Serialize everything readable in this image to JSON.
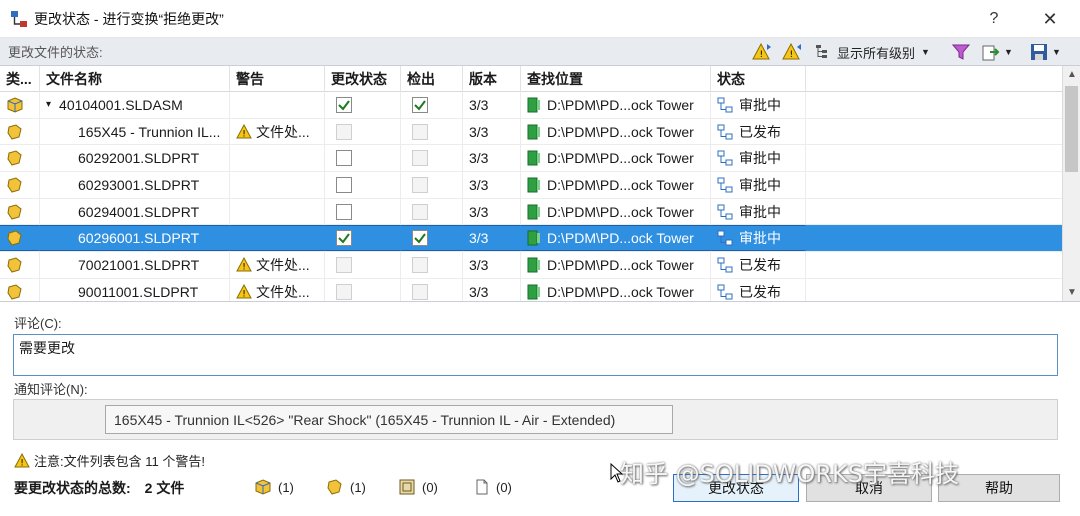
{
  "window": {
    "title": "更改状态 - 进行变换“拒绝更改”",
    "help_label": "?",
    "close_label": "✕"
  },
  "toolbar": {
    "caption": "更改文件的状态:",
    "level_filter_label": "显示所有级别"
  },
  "columns": [
    "类...",
    "文件名称",
    "警告",
    "更改状态",
    "检出",
    "版本",
    "查找位置",
    "状态"
  ],
  "rows": [
    {
      "name": "40104001.SLDASM",
      "expander": "▾",
      "warning": "",
      "change": "checked",
      "checkout": "checked",
      "version": "3/3",
      "location": "D:\\PDM\\PD...ock Tower",
      "state": "审批中",
      "selected": false,
      "kind": "assembly"
    },
    {
      "name": "165X45 - Trunnion IL...",
      "expander": "",
      "warning": "文件处...",
      "change": "disabled",
      "checkout": "disabled",
      "version": "3/3",
      "location": "D:\\PDM\\PD...ock Tower",
      "state": "已发布",
      "selected": false,
      "kind": "part"
    },
    {
      "name": "60292001.SLDPRT",
      "expander": "",
      "warning": "",
      "change": "unchecked",
      "checkout": "disabled",
      "version": "3/3",
      "location": "D:\\PDM\\PD...ock Tower",
      "state": "审批中",
      "selected": false,
      "kind": "part"
    },
    {
      "name": "60293001.SLDPRT",
      "expander": "",
      "warning": "",
      "change": "unchecked",
      "checkout": "disabled",
      "version": "3/3",
      "location": "D:\\PDM\\PD...ock Tower",
      "state": "审批中",
      "selected": false,
      "kind": "part"
    },
    {
      "name": "60294001.SLDPRT",
      "expander": "",
      "warning": "",
      "change": "unchecked",
      "checkout": "disabled",
      "version": "3/3",
      "location": "D:\\PDM\\PD...ock Tower",
      "state": "审批中",
      "selected": false,
      "kind": "part"
    },
    {
      "name": "60296001.SLDPRT",
      "expander": "",
      "warning": "",
      "change": "checked",
      "checkout": "checked",
      "version": "3/3",
      "location": "D:\\PDM\\PD...ock Tower",
      "state": "审批中",
      "selected": true,
      "kind": "part"
    },
    {
      "name": "70021001.SLDPRT",
      "expander": "",
      "warning": "文件处...",
      "change": "disabled",
      "checkout": "disabled",
      "version": "3/3",
      "location": "D:\\PDM\\PD...ock Tower",
      "state": "已发布",
      "selected": false,
      "kind": "part"
    },
    {
      "name": "90011001.SLDPRT",
      "expander": "",
      "warning": "文件处...",
      "change": "disabled",
      "checkout": "disabled",
      "version": "3/3",
      "location": "D:\\PDM\\PD...ock Tower",
      "state": "已发布",
      "selected": false,
      "kind": "part"
    }
  ],
  "comment": {
    "label": "评论(C):",
    "value": "需要更改"
  },
  "notify": {
    "label": "通知评论(N):",
    "item": "165X45 - Trunnion IL<526> \"Rear Shock\" (165X45 - Trunnion IL - Air - Extended)"
  },
  "warning_note": "注意:文件列表包含 11 个警告!",
  "totals": {
    "label": "要更改状态的总数:",
    "value": "2 文件"
  },
  "counts": [
    "(1)",
    "(1)",
    "(0)",
    "(0)"
  ],
  "buttons": {
    "ok": "更改状态",
    "cancel": "取消",
    "help": "帮助"
  },
  "watermark": "知乎 @SOLIDWORKS宇喜科技",
  "colors": {
    "selection": "#2f8fe0",
    "accent_border": "#2b6fc4",
    "toolbar_bg": "#e8ebf0"
  }
}
